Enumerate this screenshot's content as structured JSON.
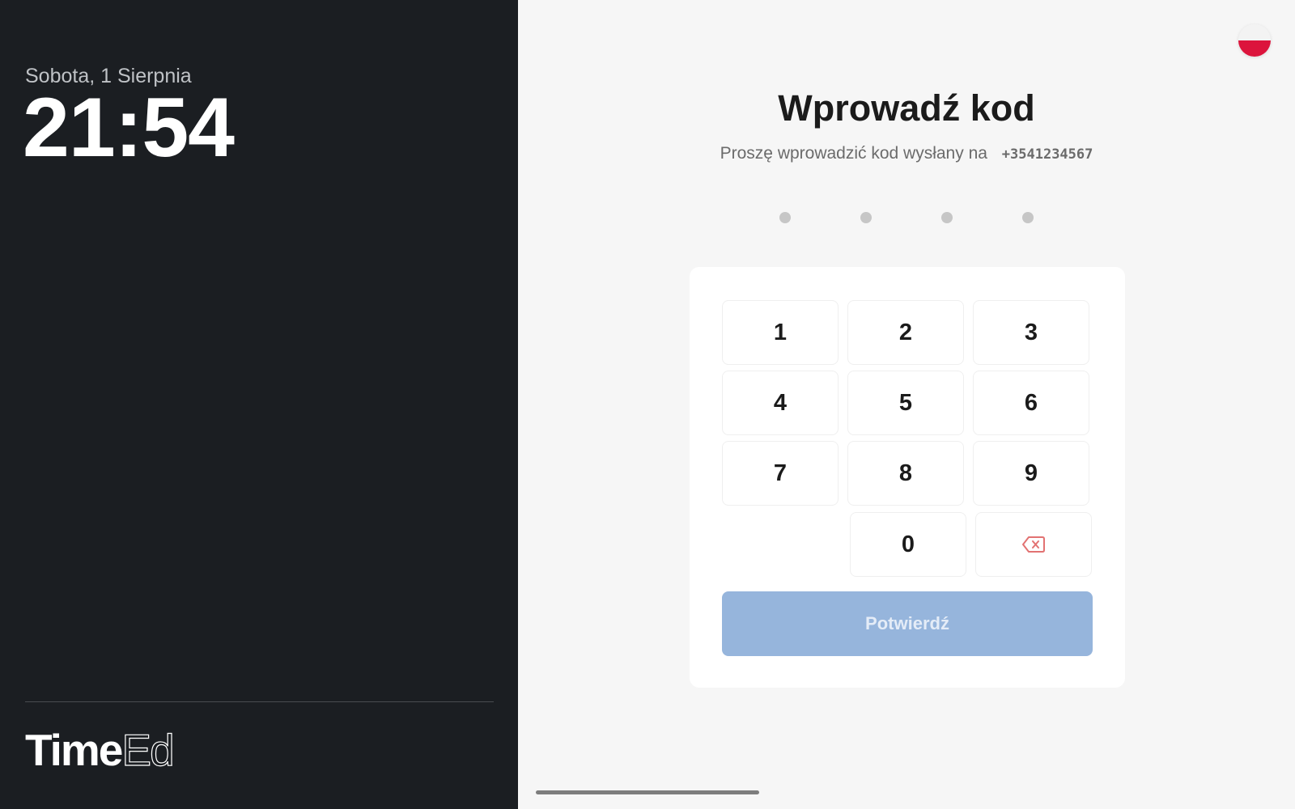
{
  "sidebar": {
    "date": "Sobota, 1 Sierpnia",
    "time": "21:54",
    "brand_bold": "Time",
    "brand_light": "Ed"
  },
  "main": {
    "title": "Wprowadź kod",
    "subtitle": "Proszę wprowadzić kod wysłany na",
    "phone": "+3541234567",
    "code_dots": 4,
    "keypad": {
      "key_1": "1",
      "key_2": "2",
      "key_3": "3",
      "key_4": "4",
      "key_5": "5",
      "key_6": "6",
      "key_7": "7",
      "key_8": "8",
      "key_9": "9",
      "key_0": "0",
      "backspace_icon": "backspace-icon"
    },
    "confirm_label": "Potwierdź"
  },
  "language": {
    "flag_icon": "poland-flag-icon"
  },
  "colors": {
    "sidebar_bg": "#1b1e22",
    "page_bg": "#f6f6f6",
    "confirm_bg": "#96b5dc",
    "backspace": "#e27272",
    "flag_red": "#dc143c"
  }
}
